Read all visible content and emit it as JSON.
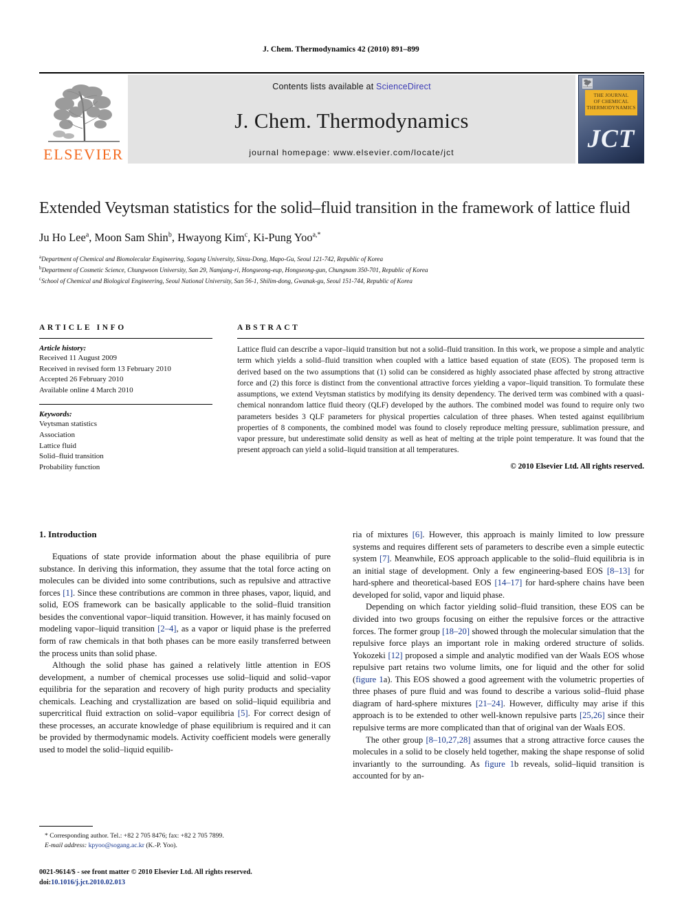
{
  "running_head": "J. Chem. Thermodynamics 42 (2010) 891–899",
  "masthead": {
    "publisher_name": "ELSEVIER",
    "contents_prefix": "Contents lists available at ",
    "sciencedirect": "ScienceDirect",
    "journal_title": "J. Chem. Thermodynamics",
    "homepage": "journal homepage: www.elsevier.com/locate/jct",
    "cover": {
      "band_line1": "THE JOURNAL",
      "band_line2": "OF CHEMICAL",
      "band_line3": "THERMODYNAMICS",
      "initials": "JCT",
      "band_color": "#f0b429",
      "background_color": "#3c4c70"
    },
    "accent_color": "#F36B21",
    "link_color": "#3a3ab5",
    "band_background": "#e3e3e3"
  },
  "title": "Extended Veytsman statistics for the solid–fluid transition in the framework of lattice fluid",
  "authors": [
    {
      "name": "Ju Ho Lee",
      "marks": "a"
    },
    {
      "name": "Moon Sam Shin",
      "marks": "b"
    },
    {
      "name": "Hwayong Kim",
      "marks": "c"
    },
    {
      "name": "Ki-Pung Yoo",
      "marks": "a,*"
    }
  ],
  "affiliations": [
    {
      "mark": "a",
      "text": "Department of Chemical and Biomolecular Engineering, Sogang University, Sinsu-Dong, Mapo-Gu, Seoul 121-742, Republic of Korea"
    },
    {
      "mark": "b",
      "text": "Department of Cosmetic Science, Chungwoon University, San 29, Namjang-ri, Hongseong-eup, Hongseong-gun, Chungnam 350-701, Republic of Korea"
    },
    {
      "mark": "c",
      "text": "School of Chemical and Biological Engineering, Seoul National University, San 56-1, Shilim-dong, Gwanak-gu, Seoul 151-744, Republic of Korea"
    }
  ],
  "article_info": {
    "label": "ARTICLE INFO",
    "history_label": "Article history:",
    "history": [
      "Received 11 August 2009",
      "Received in revised form 13 February 2010",
      "Accepted 26 February 2010",
      "Available online 4 March 2010"
    ],
    "keywords_label": "Keywords:",
    "keywords": [
      "Veytsman statistics",
      "Association",
      "Lattice fluid",
      "Solid–fluid transition",
      "Probability function"
    ]
  },
  "abstract": {
    "label": "ABSTRACT",
    "text": "Lattice fluid can describe a vapor–liquid transition but not a solid–fluid transition. In this work, we propose a simple and analytic term which yields a solid–fluid transition when coupled with a lattice based equation of state (EOS). The proposed term is derived based on the two assumptions that (1) solid can be considered as highly associated phase affected by strong attractive force and (2) this force is distinct from the conventional attractive forces yielding a vapor–liquid transition. To formulate these assumptions, we extend Veytsman statistics by modifying its density dependency. The derived term was combined with a quasi-chemical nonrandom lattice fluid theory (QLF) developed by the authors. The combined model was found to require only two parameters besides 3 QLF parameters for physical properties calculation of three phases. When tested against equilibrium properties of 8 components, the combined model was found to closely reproduce melting pressure, sublimation pressure, and vapor pressure, but underestimate solid density as well as heat of melting at the triple point temperature. It was found that the present approach can yield a solid–liquid transition at all temperatures.",
    "copyright": "© 2010 Elsevier Ltd. All rights reserved."
  },
  "body": {
    "section_number_title": "1. Introduction",
    "left_paragraphs": [
      "Equations of state provide information about the phase equilibria of pure substance. In deriving this information, they assume that the total force acting on molecules can be divided into some contributions, such as repulsive and attractive forces [1]. Since these contributions are common in three phases, vapor, liquid, and solid, EOS framework can be basically applicable to the solid–fluid transition besides the conventional vapor–liquid transition. However, it has mainly focused on modeling vapor–liquid transition [2–4], as a vapor or liquid phase is the preferred form of raw chemicals in that both phases can be more easily transferred between the process units than solid phase.",
      "Although the solid phase has gained a relatively little attention in EOS development, a number of chemical processes use solid–liquid and solid–vapor equilibria for the separation and recovery of high purity products and speciality chemicals. Leaching and crystallization are based on solid–liquid equilibria and supercritical fluid extraction on solid–vapor equilibria [5]. For correct design of these processes, an accurate knowledge of phase equilibrium is required and it can be provided by thermodynamic models. Activity coefficient models were generally used to model the solid–liquid equilib-"
    ],
    "right_paragraphs": [
      "ria of mixtures [6]. However, this approach is mainly limited to low pressure systems and requires different sets of parameters to describe even a simple eutectic system [7]. Meanwhile, EOS approach applicable to the solid–fluid equilibria is in an initial stage of development. Only a few engineering-based EOS [8–13] for hard-sphere and theoretical-based EOS [14–17] for hard-sphere chains have been developed for solid, vapor and liquid phase.",
      "Depending on which factor yielding solid–fluid transition, these EOS can be divided into two groups focusing on either the repulsive forces or the attractive forces. The former group [18–20] showed through the molecular simulation that the repulsive force plays an important role in making ordered structure of solids. Yokozeki [12] proposed a simple and analytic modified van der Waals EOS whose repulsive part retains two volume limits, one for liquid and the other for solid (figure 1a). This EOS showed a good agreement with the volumetric properties of three phases of pure fluid and was found to describe a various solid–fluid phase diagram of hard-sphere mixtures [21–24]. However, difficulty may arise if this approach is to be extended to other well-known repulsive parts [25,26] since their repulsive terms are more complicated than that of original van der Waals EOS.",
      "The other group [8–10,27,28] assumes that a strong attractive force causes the molecules in a solid to be closely held together, making the shape response of solid invariantly to the surrounding. As figure 1b reveals, solid–liquid transition is accounted for by an-"
    ]
  },
  "footnote": {
    "corresponding": "* Corresponding author. Tel.: +82 2 705 8476; fax: +82 2 705 7899.",
    "email_label": "E-mail address:",
    "email": "kpyoo@sogang.ac.kr",
    "email_suffix": " (K.-P. Yoo)."
  },
  "imprint": {
    "line1": "0021-9614/$ - see front matter © 2010 Elsevier Ltd. All rights reserved.",
    "doi_prefix": "doi:",
    "doi": "10.1016/j.jct.2010.02.013"
  }
}
